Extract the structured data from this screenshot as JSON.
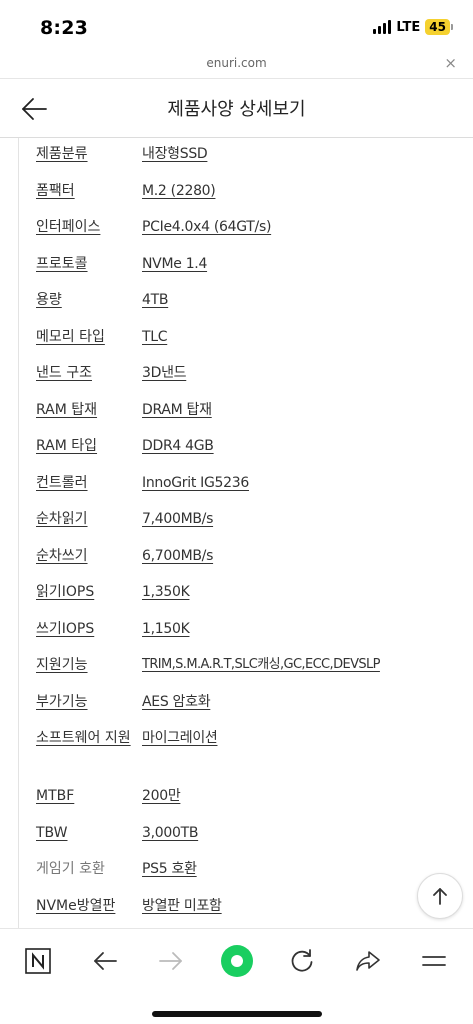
{
  "status_bar": {
    "time": "8:23",
    "network": "LTE",
    "battery": "45",
    "battery_color": "#f5d12f"
  },
  "url_bar": {
    "domain": "enuri.com",
    "close_symbol": "×"
  },
  "header": {
    "title": "제품사양 상세보기"
  },
  "specs": [
    {
      "label": "제품분류",
      "value": "내장형SSD"
    },
    {
      "label": "폼팩터",
      "value": "M.2 (2280)"
    },
    {
      "label": "인터페이스",
      "value": "PCIe4.0x4 (64GT/s)"
    },
    {
      "label": "프로토콜",
      "value": "NVMe 1.4"
    },
    {
      "label": "용량",
      "value": "4TB"
    },
    {
      "label": "메모리 타입",
      "value": "TLC"
    },
    {
      "label": "낸드 구조",
      "value": "3D낸드"
    },
    {
      "label": "RAM 탑재",
      "value": "DRAM 탑재"
    },
    {
      "label": "RAM 타입",
      "value": "DDR4 4GB"
    },
    {
      "label": "컨트롤러",
      "value": "InnoGrit IG5236"
    },
    {
      "label": "순차읽기",
      "value": "7,400MB/s"
    },
    {
      "label": "순차쓰기",
      "value": "6,700MB/s"
    },
    {
      "label": "읽기IOPS",
      "value": "1,350K"
    },
    {
      "label": "쓰기IOPS",
      "value": "1,150K"
    },
    {
      "label": "지원기능",
      "value": "TRIM,S.M.A.R.T,SLC캐싱,GC,ECC,DEVSLP"
    },
    {
      "label": "부가기능",
      "value": "AES 암호화"
    },
    {
      "label": "소프트웨어 지원",
      "value": "마이그레이션"
    },
    {
      "label": "MTBF",
      "value": "200만"
    },
    {
      "label": "TBW",
      "value": "3,000TB"
    },
    {
      "label": "게임기 호환",
      "value": "PS5 호환"
    },
    {
      "label": "NVMe방열판",
      "value": "방열판 미포함"
    }
  ],
  "toolbar": {
    "icons": [
      "naver-n-icon",
      "back-arrow-icon",
      "forward-arrow-icon",
      "green-dot-icon",
      "refresh-icon",
      "share-icon",
      "menu-icon"
    ],
    "accent_color": "#19ce60"
  }
}
